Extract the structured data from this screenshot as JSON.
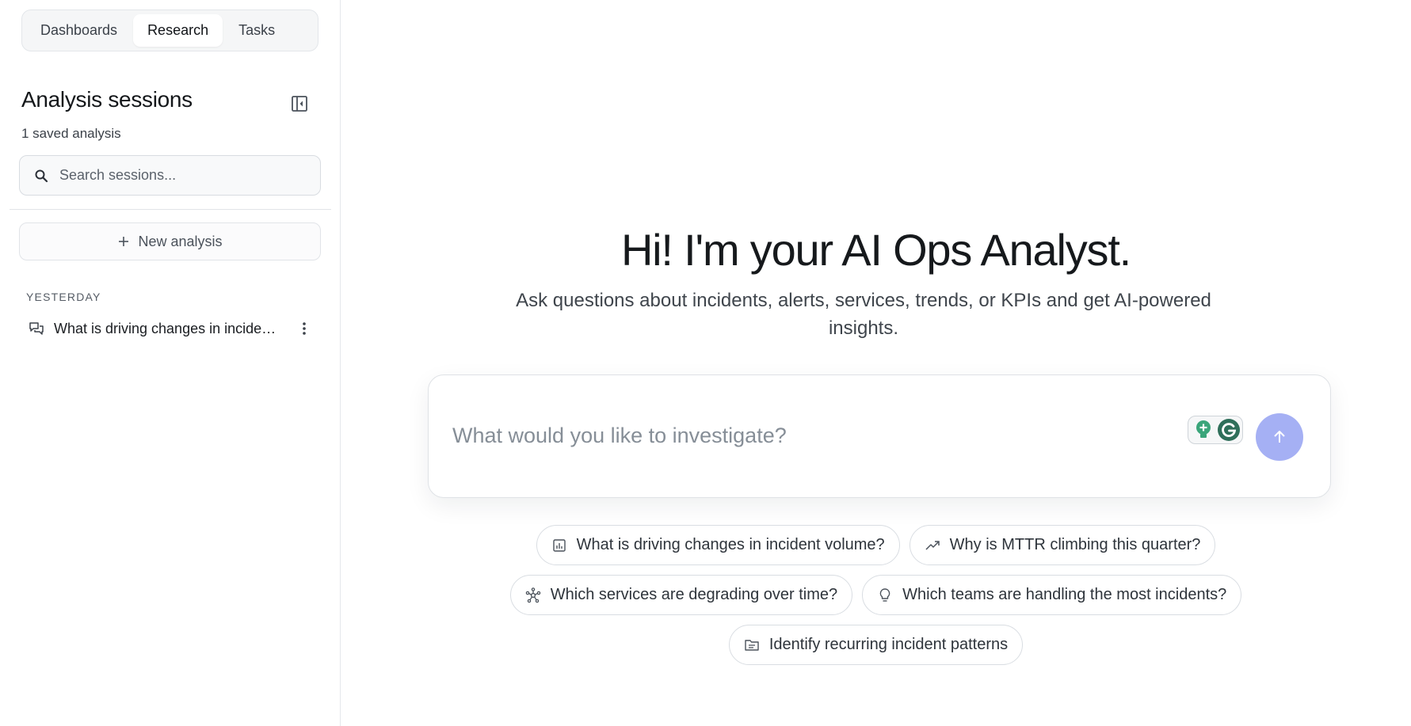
{
  "nav": {
    "tabs": [
      {
        "label": "Dashboards",
        "active": false
      },
      {
        "label": "Research",
        "active": true
      },
      {
        "label": "Tasks",
        "active": false
      }
    ]
  },
  "sidebar": {
    "title": "Analysis sessions",
    "saved_count": "1 saved analysis",
    "search_placeholder": "Search sessions...",
    "new_analysis_label": "New analysis",
    "groups": [
      {
        "label": "YESTERDAY",
        "items": [
          {
            "title": "What is driving changes in incident volume?",
            "icon": "chat-bubbles-icon"
          }
        ]
      }
    ]
  },
  "main": {
    "heading": "Hi! I'm your AI Ops Analyst.",
    "subheading": "Ask questions about incidents, alerts, services, trends, or KPIs and get AI-powered insights.",
    "composer_placeholder": "What would you like to investigate?",
    "send_color": "#a5b0f4",
    "suggestions": [
      {
        "label": "What is driving changes in incident volume?",
        "icon": "bar-chart-icon"
      },
      {
        "label": "Why is MTTR climbing this quarter?",
        "icon": "trend-up-icon"
      },
      {
        "label": "Which services are degrading over time?",
        "icon": "network-icon"
      },
      {
        "label": "Which teams are handling the most incidents?",
        "icon": "lightbulb-icon"
      },
      {
        "label": "Identify recurring incident patterns",
        "icon": "folder-icon"
      }
    ]
  }
}
